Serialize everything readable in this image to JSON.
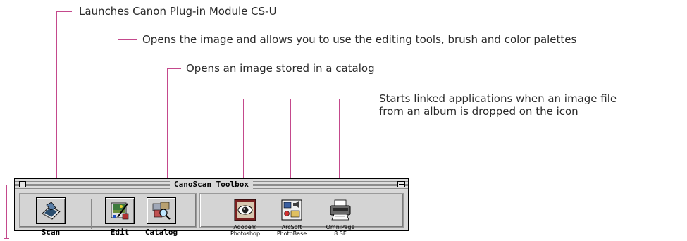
{
  "callouts": {
    "scan": "Launches Canon Plug-in Module CS-U",
    "edit": "Opens the image and allows you to use the editing tools, brush and color palettes",
    "catalog": "Opens an image stored in a catalog",
    "apps_line1": "Starts linked applications when an image file",
    "apps_line2": "from an album is dropped on the icon"
  },
  "window": {
    "title": "CanoScan Toolbox"
  },
  "tools": [
    {
      "label": "Scan",
      "icon": "scanner-icon"
    },
    {
      "label": "Edit",
      "icon": "edit-palette-icon"
    },
    {
      "label": "Catalog",
      "icon": "catalog-magnifier-icon"
    }
  ],
  "apps": [
    {
      "label": "Adobe®\nPhotoshop",
      "icon": "photoshop-eye-icon"
    },
    {
      "label": "ArcSoft\nPhotoBase",
      "icon": "photobase-icon"
    },
    {
      "label": "OmniPage\n8 SE",
      "icon": "omnipage-printer-icon"
    }
  ],
  "colors": {
    "callout_line": "#c4498c",
    "window_bg": "#d8d8d8"
  }
}
